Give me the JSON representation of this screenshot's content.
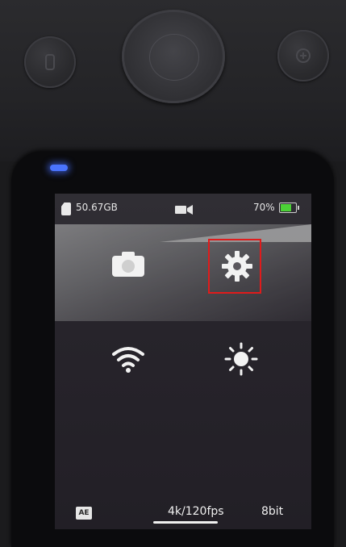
{
  "status": {
    "storage": "50.67GB",
    "battery_percent": "70%",
    "battery_level": 0.7,
    "mode_icon": "video-camera-icon",
    "battery_color": "#4cd137"
  },
  "menu": {
    "items": [
      {
        "icon": "camera-icon"
      },
      {
        "icon": "gear-icon",
        "highlighted": true
      },
      {
        "icon": "wifi-icon"
      },
      {
        "icon": "brightness-icon"
      }
    ],
    "highlight_color": "#e01b1b"
  },
  "bottom": {
    "ae_label": "AE",
    "resolution": "4k/120fps",
    "bit_depth": "8bit"
  },
  "device": {
    "led_color": "#4a74ff"
  }
}
